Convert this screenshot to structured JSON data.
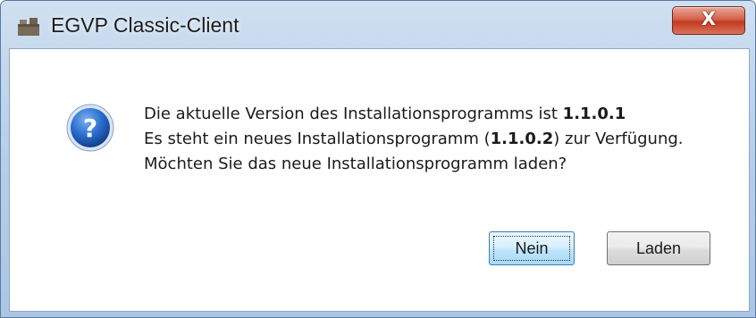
{
  "window": {
    "title": "EGVP Classic-Client",
    "close_symbol": "X"
  },
  "message": {
    "line1_prefix": "Die aktuelle Version des Installationsprogramms ist ",
    "line1_version": "1.1.0.1",
    "line2_prefix": "Es steht ein neues Installationsprogramm (",
    "line2_version": "1.1.0.2",
    "line2_suffix": ") zur Verfügung.",
    "line3": "Möchten Sie das neue Installationsprogramm laden?",
    "icon": "question-icon"
  },
  "buttons": {
    "nein_label": "Nein",
    "laden_label": "Laden"
  },
  "colors": {
    "titlebar": "#b9d1ea",
    "close_button": "#c23a1f",
    "question_icon": "#1f5fbf"
  }
}
